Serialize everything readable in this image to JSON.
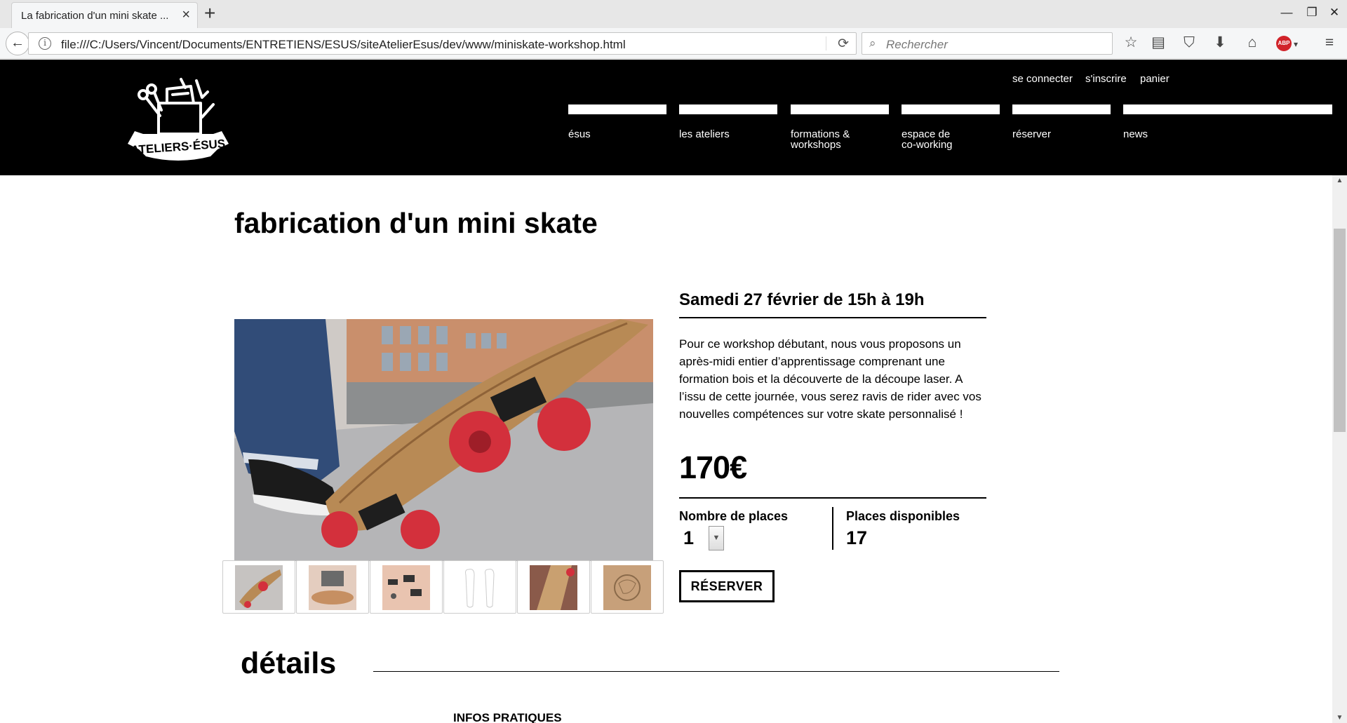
{
  "browser": {
    "tab_title": "La fabrication d'un mini skate ...",
    "tab_close": "×",
    "new_tab": "+",
    "url": "file:///C:/Users/Vincent/Documents/ENTRETIENS/ESUS/siteAtelierEsus/dev/www/miniskate-workshop.html",
    "search_placeholder": "Rechercher",
    "window_controls": {
      "minimize": "—",
      "restore": "❐",
      "close": "✕"
    }
  },
  "site": {
    "logo_text": "ATELIERS·ÉSUS",
    "utility_links": [
      "se connecter",
      "s'inscrire",
      "panier"
    ],
    "nav": [
      {
        "label": "ésus",
        "label2": ""
      },
      {
        "label": "les ateliers",
        "label2": ""
      },
      {
        "label": "formations &",
        "label2": "workshops"
      },
      {
        "label": "espace de",
        "label2": "co-working"
      },
      {
        "label": "réserver",
        "label2": ""
      },
      {
        "label": "news",
        "label2": ""
      }
    ]
  },
  "product": {
    "title": "fabrication d'un mini skate",
    "date": "Samedi 27 février de 15h à 19h",
    "description": "Pour ce workshop débutant, nous vous proposons un après-midi entier d’apprentissage comprenant une formation bois et la découverte de la découpe laser. A l’issu de cette journée, vous serez ravis de rider avec vos nouvelles compétences sur votre skate personnalisé !",
    "price": "170€",
    "quantity_label": "Nombre de places",
    "quantity_value": "1",
    "available_label": "Places disponibles",
    "available_value": "17",
    "reserve_button": "RÉSERVER",
    "thumbnail_count": 6
  },
  "details": {
    "title": "détails",
    "infos_title": "INFOS PRATIQUES"
  },
  "colors": {
    "header_bg": "#000000",
    "board_wood": "#b88a55",
    "wheel_red": "#d3303c"
  }
}
